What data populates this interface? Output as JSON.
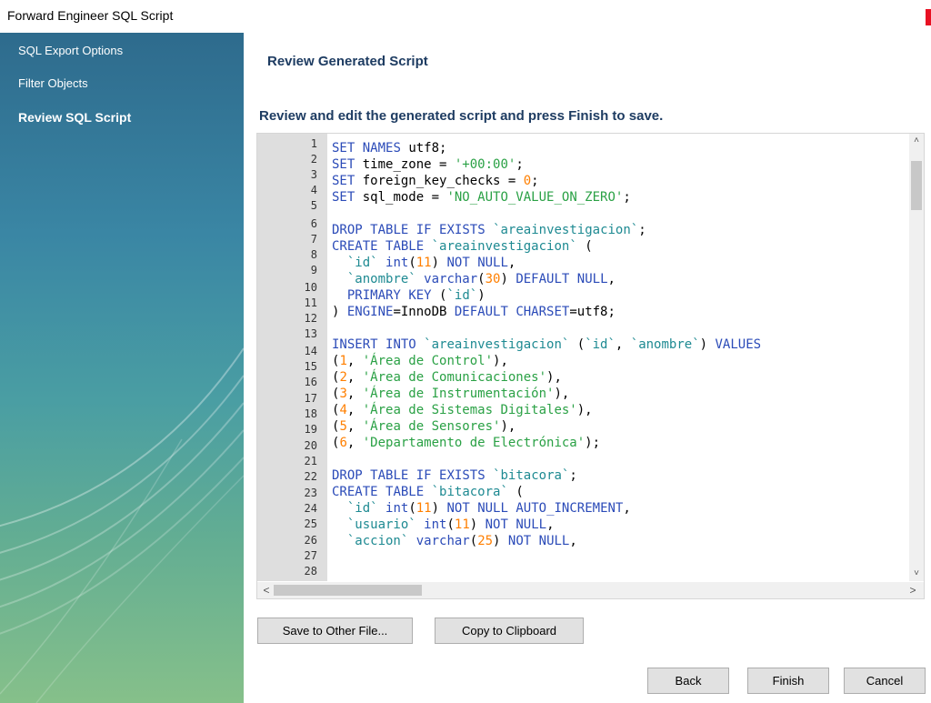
{
  "window": {
    "title": "Forward Engineer SQL Script"
  },
  "sidebar": {
    "items": [
      {
        "label": "SQL Export Options",
        "active": false
      },
      {
        "label": "Filter Objects",
        "active": false
      },
      {
        "label": "Review SQL Script",
        "active": true
      }
    ]
  },
  "main": {
    "title": "Review Generated Script",
    "instructions": "Review and edit the generated script and press Finish to save."
  },
  "editor": {
    "line_numbers": [
      "1",
      "2",
      "3",
      "4",
      "5",
      "6",
      "7",
      "8",
      "9",
      "10",
      "11",
      "12",
      "13",
      "14",
      "15",
      "16",
      "17",
      "18",
      "19",
      "20",
      "21",
      "22",
      "23",
      "24",
      "25",
      "26",
      "27",
      "28"
    ],
    "code_lines": [
      "SET NAMES utf8;",
      "SET time_zone = '+00:00';",
      "SET foreign_key_checks = 0;",
      "SET sql_mode = 'NO_AUTO_VALUE_ON_ZERO';",
      "",
      "DROP TABLE IF EXISTS `areainvestigacion`;",
      "CREATE TABLE `areainvestigacion` (",
      "  `id` int(11) NOT NULL,",
      "  `anombre` varchar(30) DEFAULT NULL,",
      "  PRIMARY KEY (`id`)",
      ") ENGINE=InnoDB DEFAULT CHARSET=utf8;",
      "",
      "INSERT INTO `areainvestigacion` (`id`, `anombre`) VALUES",
      "(1, 'Área de Control'),",
      "(2, 'Área de Comunicaciones'),",
      "(3, 'Área de Instrumentación'),",
      "(4, 'Área de Sistemas Digitales'),",
      "(5, 'Área de Sensores'),",
      "(6, 'Departamento de Electrónica');",
      "",
      "DROP TABLE IF EXISTS `bitacora`;",
      "CREATE TABLE `bitacora` (",
      "  `id` int(11) NOT NULL AUTO_INCREMENT,",
      "  `usuario` int(11) NOT NULL,",
      "  `accion` varchar(25) NOT NULL,"
    ]
  },
  "buttons": {
    "save_to_file": "Save to Other File...",
    "copy_clipboard": "Copy to Clipboard",
    "back": "Back",
    "finish": "Finish",
    "cancel": "Cancel"
  },
  "scroll_icons": {
    "up": "˄",
    "down": "˅",
    "left": "<",
    "right": ">"
  },
  "colors": {
    "keyword": "#2b4bb8",
    "string": "#2aa145",
    "number": "#ff7f00",
    "backtick_identifier": "#1e8a92",
    "heading": "#1e3c62"
  }
}
